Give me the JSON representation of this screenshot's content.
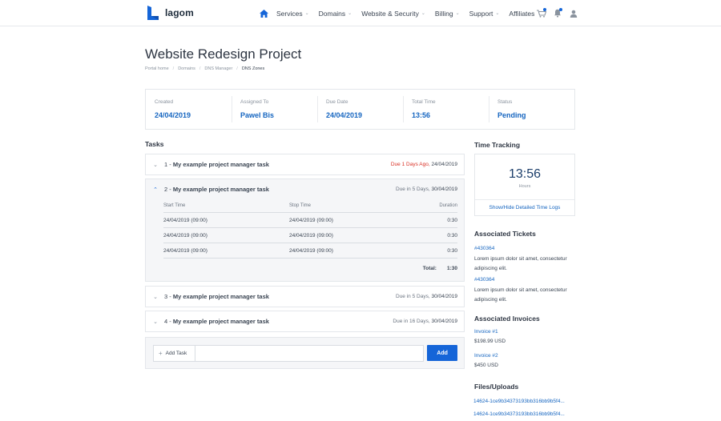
{
  "header": {
    "brand": "lagom",
    "nav": [
      {
        "label": "Services",
        "caret": true
      },
      {
        "label": "Domains",
        "caret": true
      },
      {
        "label": "Website & Security",
        "caret": true
      },
      {
        "label": "Billing",
        "caret": true
      },
      {
        "label": "Support",
        "caret": true
      },
      {
        "label": "Affiliates",
        "caret": false
      }
    ],
    "accent": "#1565d8"
  },
  "page": {
    "title": "Website Redesign Project",
    "breadcrumb": [
      "Portal home",
      "Domains",
      "DNS Manager",
      "DNS Zones"
    ]
  },
  "summary": [
    {
      "label": "Created",
      "value": "24/04/2019"
    },
    {
      "label": "Assigned To",
      "value": "Pawel Bis"
    },
    {
      "label": "Due Date",
      "value": "24/04/2019"
    },
    {
      "label": "Total Time",
      "value": "13:56"
    },
    {
      "label": "Status",
      "value": "Pending"
    }
  ],
  "tasks_title": "Tasks",
  "tasks": [
    {
      "num": "1 -",
      "name": "My example project manager task",
      "due_label": "Due 1 Days Ago,",
      "due_date": "24/04/2019",
      "overdue": true,
      "expanded": false
    },
    {
      "num": "2 -",
      "name": "My example project manager task",
      "due_label": "Due in 5 Days,",
      "due_date": "30/04/2019",
      "overdue": false,
      "expanded": true
    },
    {
      "num": "3 -",
      "name": "My example project manager task",
      "due_label": "Due in 5 Days,",
      "due_date": "30/04/2019",
      "overdue": false,
      "expanded": false
    },
    {
      "num": "4 -",
      "name": "My example project manager task",
      "due_label": "Due in 16 Days,",
      "due_date": "30/04/2019",
      "overdue": false,
      "expanded": false
    }
  ],
  "logs": {
    "headers": [
      "Start Time",
      "Stop Time",
      "Duration"
    ],
    "rows": [
      [
        "24/04/2019 (09:00)",
        "24/04/2019 (09:00)",
        "0:30"
      ],
      [
        "24/04/2019 (09:00)",
        "24/04/2019 (09:00)",
        "0:30"
      ],
      [
        "24/04/2019 (09:00)",
        "24/04/2019 (09:00)",
        "0:30"
      ]
    ],
    "total_label": "Total:",
    "total_value": "1:30"
  },
  "add_task": {
    "label": "Add Task",
    "button": "Add",
    "placeholder": ""
  },
  "time_tracking": {
    "title": "Time Tracking",
    "time": "13:56",
    "unit": "Hours",
    "link": "Show/Hide Detailed Time Logs"
  },
  "tickets": {
    "title": "Associated Tickets",
    "items": [
      {
        "id": "#430364",
        "text": "Lorem ipsum dolor sit amet, consectetur adipiscing elit."
      },
      {
        "id": "#430364",
        "text": "Lorem ipsum dolor sit amet, consectetur adipiscing elit."
      }
    ]
  },
  "invoices": {
    "title": "Associated Invoices",
    "items": [
      {
        "id": "Invoice #1",
        "amount": "$198.99 USD"
      },
      {
        "id": "Invoice #2",
        "amount": "$450 USD"
      }
    ]
  },
  "files": {
    "title": "Files/Uploads",
    "items": [
      "14624-1ce9b34373193bb316bb9b5f4...",
      "14624-1ce9b34373193bb316bb9b5f4..."
    ]
  }
}
